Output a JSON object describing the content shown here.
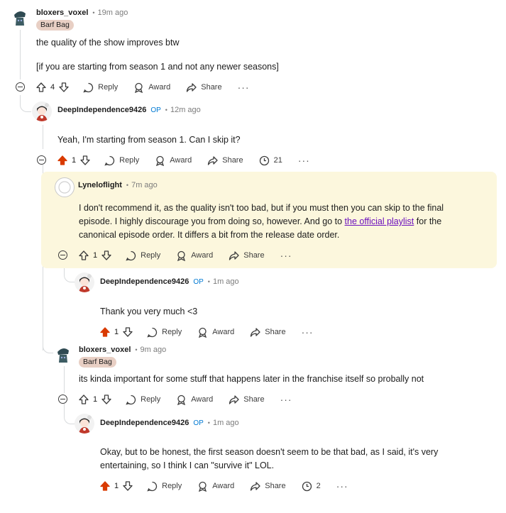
{
  "comments": {
    "c1": {
      "author": "bloxers_voxel",
      "time": "19m ago",
      "flair": "Barf Bag",
      "body_line1": "the quality of the show improves btw",
      "body_line2": "[if you are starting from season 1 and not any newer seasons]",
      "votes": "4",
      "reply_label": "Reply",
      "award_label": "Award",
      "share_label": "Share"
    },
    "c2": {
      "author": "DeepIndependence9426",
      "op_badge": "OP",
      "time": "12m ago",
      "body": "Yeah, I'm starting from season 1. Can I skip it?",
      "votes": "1",
      "reply_label": "Reply",
      "award_label": "Award",
      "share_label": "Share",
      "thread_count": "21"
    },
    "c3": {
      "author": "Lyneloflight",
      "time": "7m ago",
      "body_before_link": "I don't recommend it, as the quality isn't too bad, but if you must then you can skip to the final episode. I highly discourage you from doing so, however. And go to ",
      "link_text": "the official playlist",
      "body_after_link": " for the canonical episode order. It differs a bit from the release date order.",
      "votes": "1",
      "reply_label": "Reply",
      "award_label": "Award",
      "share_label": "Share"
    },
    "c4": {
      "author": "DeepIndependence9426",
      "op_badge": "OP",
      "time": "1m ago",
      "body": "Thank you very much <3",
      "votes": "1",
      "reply_label": "Reply",
      "award_label": "Award",
      "share_label": "Share"
    },
    "c5": {
      "author": "bloxers_voxel",
      "time": "9m ago",
      "flair": "Barf Bag",
      "body": "its kinda important for some stuff that happens later in the franchise itself so probally not",
      "votes": "1",
      "reply_label": "Reply",
      "award_label": "Award",
      "share_label": "Share"
    },
    "c6": {
      "author": "DeepIndependence9426",
      "op_badge": "OP",
      "time": "1m ago",
      "body": "Okay, but to be honest, the first season doesn't seem to be that bad, as I said, it's very entertaining, so I think I can \"survive it\" LOL.",
      "votes": "1",
      "reply_label": "Reply",
      "award_label": "Award",
      "share_label": "Share",
      "thread_count": "2"
    }
  },
  "colors": {
    "upvote_active": "#d93a00",
    "op_badge": "#0079d3",
    "highlight_bg": "#fcf7dd",
    "flair_bg": "#e8cfc4",
    "link": "#6b0fbd"
  },
  "icons": [
    "collapse-icon",
    "upvote-icon",
    "downvote-icon",
    "reply-icon",
    "award-icon",
    "share-icon",
    "thread-count-icon",
    "more-icon"
  ]
}
